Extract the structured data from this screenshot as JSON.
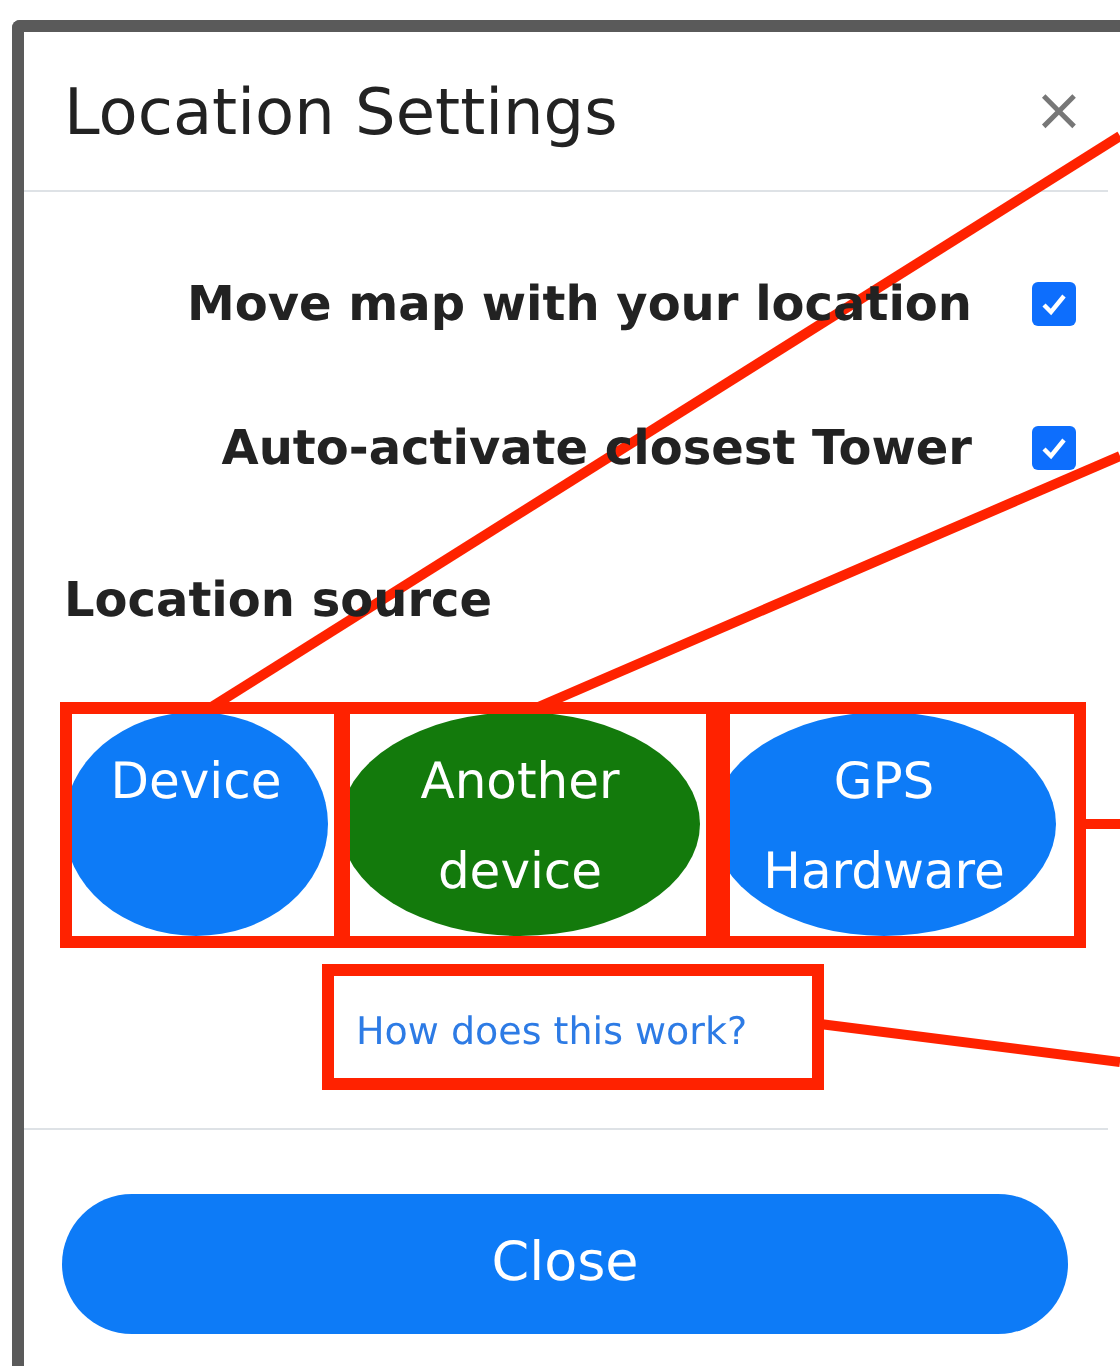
{
  "dialog": {
    "title": "Location Settings",
    "close_glyph": "×"
  },
  "options": [
    {
      "label": "Move map with your location",
      "checked": true
    },
    {
      "label": "Auto-activate closest Tower",
      "checked": true
    }
  ],
  "source": {
    "heading": "Location source",
    "buttons": [
      {
        "label": "Device",
        "selected": false
      },
      {
        "label": "Another device",
        "selected": true
      },
      {
        "label": "GPS Hardware",
        "selected": false
      }
    ],
    "help_link": "How does this work?"
  },
  "footer": {
    "button": "Close"
  }
}
